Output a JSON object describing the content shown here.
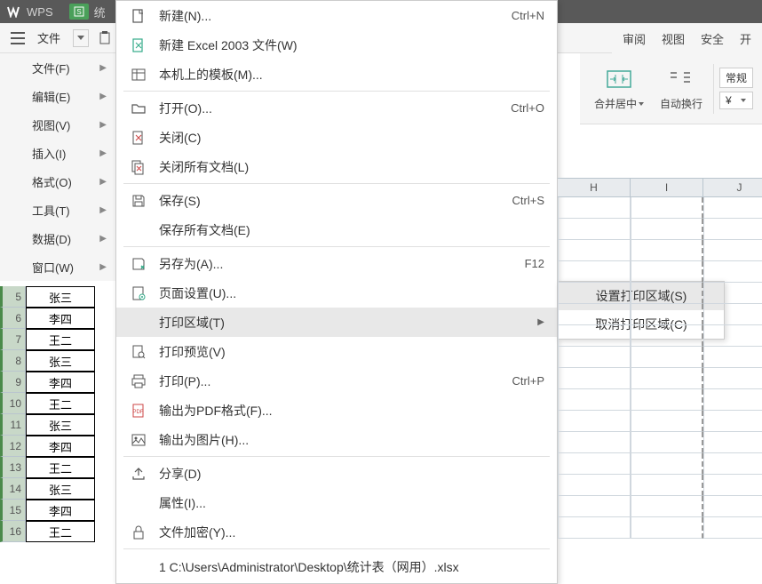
{
  "app": {
    "name": "WPS",
    "doc_initial": "统"
  },
  "toolbar": {
    "file_label": "文件"
  },
  "right_tabs": {
    "review": "审阅",
    "view": "视图",
    "security": "安全",
    "dev": "开"
  },
  "ribbon": {
    "merge_center": "合并居中",
    "auto_wrap": "自动换行",
    "format_general": "常规",
    "currency_icon": "¥"
  },
  "left_menu": [
    {
      "label": "文件(F)"
    },
    {
      "label": "编辑(E)"
    },
    {
      "label": "视图(V)"
    },
    {
      "label": "插入(I)"
    },
    {
      "label": "格式(O)"
    },
    {
      "label": "工具(T)"
    },
    {
      "label": "数据(D)"
    },
    {
      "label": "窗口(W)"
    }
  ],
  "dropdown": [
    {
      "icon": "new-file-icon",
      "label": "新建(N)...",
      "shortcut": "Ctrl+N"
    },
    {
      "icon": "new-excel-icon",
      "label": "新建 Excel 2003 文件(W)",
      "shortcut": ""
    },
    {
      "icon": "template-icon",
      "label": "本机上的模板(M)...",
      "shortcut": ""
    },
    {
      "sep": true
    },
    {
      "icon": "open-icon",
      "label": "打开(O)...",
      "shortcut": "Ctrl+O"
    },
    {
      "icon": "close-icon",
      "label": "关闭(C)",
      "shortcut": ""
    },
    {
      "icon": "close-all-icon",
      "label": "关闭所有文档(L)",
      "shortcut": ""
    },
    {
      "sep": true
    },
    {
      "icon": "save-icon",
      "label": "保存(S)",
      "shortcut": "Ctrl+S"
    },
    {
      "icon": "",
      "label": "保存所有文档(E)",
      "shortcut": ""
    },
    {
      "sep": true
    },
    {
      "icon": "save-as-icon",
      "label": "另存为(A)...",
      "shortcut": "F12"
    },
    {
      "icon": "page-setup-icon",
      "label": "页面设置(U)...",
      "shortcut": ""
    },
    {
      "icon": "",
      "label": "打印区域(T)",
      "arrow": true,
      "hover": true
    },
    {
      "icon": "print-preview-icon",
      "label": "打印预览(V)",
      "shortcut": ""
    },
    {
      "icon": "print-icon",
      "label": "打印(P)...",
      "shortcut": "Ctrl+P"
    },
    {
      "icon": "pdf-icon",
      "label": "输出为PDF格式(F)...",
      "shortcut": ""
    },
    {
      "icon": "image-export-icon",
      "label": "输出为图片(H)...",
      "shortcut": ""
    },
    {
      "sep": true
    },
    {
      "icon": "share-icon",
      "label": "分享(D)",
      "shortcut": ""
    },
    {
      "icon": "",
      "label": "属性(I)...",
      "shortcut": ""
    },
    {
      "icon": "encrypt-icon",
      "label": "文件加密(Y)...",
      "shortcut": ""
    },
    {
      "sep": true
    }
  ],
  "recent_files": [
    "1 C:\\Users\\Administrator\\Desktop\\统计表（网用）.xlsx"
  ],
  "submenu": [
    {
      "label": "设置打印区域(S)",
      "hover": true
    },
    {
      "label": "取消打印区域(C)"
    }
  ],
  "grid": {
    "cols_right": [
      "H",
      "I",
      "J"
    ],
    "rows": [
      {
        "n": "5",
        "a": "张三"
      },
      {
        "n": "6",
        "a": "李四"
      },
      {
        "n": "7",
        "a": "王二"
      },
      {
        "n": "8",
        "a": "张三"
      },
      {
        "n": "9",
        "a": "李四"
      },
      {
        "n": "10",
        "a": "王二"
      },
      {
        "n": "11",
        "a": "张三"
      },
      {
        "n": "12",
        "a": "李四"
      },
      {
        "n": "13",
        "a": "王二"
      },
      {
        "n": "14",
        "a": "张三"
      },
      {
        "n": "15",
        "a": "李四"
      },
      {
        "n": "16",
        "a": "王二"
      }
    ]
  }
}
